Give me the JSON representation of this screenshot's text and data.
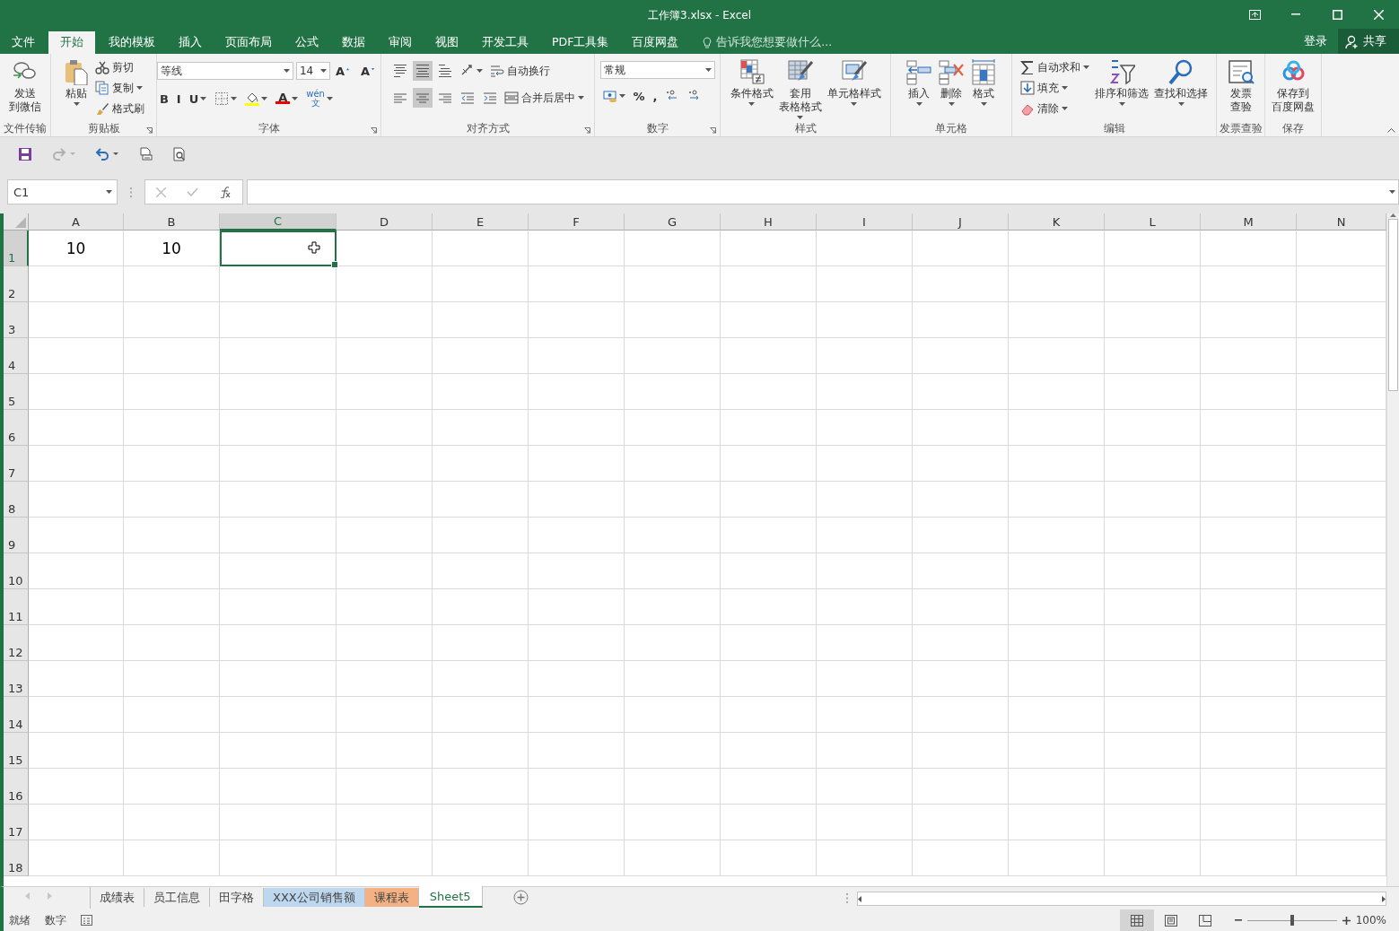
{
  "window": {
    "title": "工作簿3.xlsx - Excel"
  },
  "menu_tabs": [
    {
      "label": "文件",
      "selected": false
    },
    {
      "label": "开始",
      "selected": true
    },
    {
      "label": "我的模板",
      "selected": false
    },
    {
      "label": "插入",
      "selected": false
    },
    {
      "label": "页面布局",
      "selected": false
    },
    {
      "label": "公式",
      "selected": false
    },
    {
      "label": "数据",
      "selected": false
    },
    {
      "label": "审阅",
      "selected": false
    },
    {
      "label": "视图",
      "selected": false
    },
    {
      "label": "开发工具",
      "selected": false
    },
    {
      "label": "PDF工具集",
      "selected": false
    },
    {
      "label": "百度网盘",
      "selected": false
    }
  ],
  "tell_me": {
    "placeholder": "告诉我您想要做什么..."
  },
  "account": {
    "login": "登录",
    "share": "共享"
  },
  "ribbon": [
    {
      "name": "文件传输",
      "launcher": false,
      "items": [
        {
          "kind": "large",
          "lines": [
            "发送",
            "到微信"
          ],
          "dropdown": false
        }
      ]
    },
    {
      "name": "剪贴板",
      "launcher": true,
      "items": [
        {
          "kind": "large",
          "lines": [
            "粘贴"
          ],
          "dropdown": true
        },
        {
          "kind": "stack",
          "items": [
            {
              "label": "剪切",
              "dropdown": false
            },
            {
              "label": "复制",
              "dropdown": true
            },
            {
              "label": "格式刷",
              "dropdown": false
            }
          ]
        }
      ]
    },
    {
      "name": "字体",
      "launcher": true,
      "items": [
        {
          "kind": "toolbars",
          "toolbars": [
            {
              "tools": [
                {
                  "kind": "field",
                  "value": "等线",
                  "dropdown": true
                },
                {
                  "kind": "field",
                  "value": "14",
                  "dropdown": true
                },
                {
                  "kind": "tool",
                  "lines": [
                    "A"
                  ],
                  "dropdown": false
                },
                {
                  "kind": "tool",
                  "lines": [
                    "A"
                  ],
                  "dropdown": false
                }
              ]
            },
            {
              "tools": [
                {
                  "kind": "tool",
                  "lines": [
                    "B"
                  ],
                  "dropdown": false
                },
                {
                  "kind": "tool",
                  "lines": [
                    "I"
                  ],
                  "dropdown": false
                },
                {
                  "kind": "tool",
                  "lines": [
                    "U"
                  ],
                  "dropdown": true
                },
                {
                  "kind": "tool",
                  "dropdown": true
                },
                {
                  "kind": "tool",
                  "dropdown": true
                },
                {
                  "kind": "tool",
                  "lines": [
                    "A"
                  ],
                  "dropdown": true
                },
                {
                  "kind": "tool",
                  "lines": [
                    "wén",
                    "文"
                  ],
                  "dropdown": true
                }
              ]
            }
          ]
        }
      ]
    },
    {
      "name": "对齐方式",
      "launcher": true,
      "items": [
        {
          "kind": "toolbars",
          "toolbars": [
            {
              "tools": [
                {
                  "kind": "tool",
                  "dropdown": false,
                  "on": false
                },
                {
                  "kind": "tool",
                  "dropdown": false,
                  "on": true
                },
                {
                  "kind": "tool",
                  "dropdown": false,
                  "on": false
                },
                {
                  "kind": "tool",
                  "dropdown": true,
                  "on": false
                },
                {
                  "kind": "button",
                  "label": "自动换行",
                  "dropdown": false
                }
              ]
            },
            {
              "tools": [
                {
                  "kind": "tool",
                  "dropdown": false,
                  "on": false
                },
                {
                  "kind": "tool",
                  "dropdown": false,
                  "on": true
                },
                {
                  "kind": "tool",
                  "dropdown": false,
                  "on": false
                },
                {
                  "kind": "tool",
                  "dropdown": false,
                  "on": false
                },
                {
                  "kind": "tool",
                  "dropdown": false,
                  "on": false
                },
                {
                  "kind": "button",
                  "label": "合并后居中",
                  "dropdown": true
                }
              ]
            }
          ]
        }
      ]
    },
    {
      "name": "数字",
      "launcher": true,
      "items": [
        {
          "kind": "toolbars",
          "toolbars": [
            {
              "tools": [
                {
                  "kind": "field",
                  "value": "常规",
                  "dropdown": true
                }
              ]
            },
            {
              "tools": [
                {
                  "kind": "tool",
                  "dropdown": true
                },
                {
                  "kind": "tool",
                  "lines": [
                    "%"
                  ],
                  "dropdown": false
                },
                {
                  "kind": "tool",
                  "lines": [
                    ","
                  ],
                  "dropdown": false
                },
                {
                  "kind": "tool",
                  "dropdown": false
                },
                {
                  "kind": "tool",
                  "dropdown": false
                }
              ]
            }
          ]
        }
      ]
    },
    {
      "name": "样式",
      "launcher": false,
      "items": [
        {
          "kind": "large",
          "lines": [
            "条件格式"
          ],
          "dropdown": true
        },
        {
          "kind": "large",
          "lines": [
            "套用",
            "表格格式"
          ],
          "dropdown": true
        },
        {
          "kind": "large",
          "lines": [
            "单元格样式"
          ],
          "dropdown": true
        }
      ]
    },
    {
      "name": "单元格",
      "launcher": false,
      "items": [
        {
          "kind": "large",
          "lines": [
            "插入"
          ],
          "dropdown": true
        },
        {
          "kind": "large",
          "lines": [
            "删除"
          ],
          "dropdown": true
        },
        {
          "kind": "large",
          "lines": [
            "格式"
          ],
          "dropdown": true
        }
      ]
    },
    {
      "name": "编辑",
      "launcher": false,
      "items": [
        {
          "kind": "stack",
          "items": [
            {
              "label": "自动求和",
              "dropdown": true
            },
            {
              "label": "填充",
              "dropdown": true
            },
            {
              "label": "清除",
              "dropdown": true
            }
          ]
        },
        {
          "kind": "large",
          "lines": [
            "排序和筛选"
          ],
          "dropdown": true
        },
        {
          "kind": "large",
          "lines": [
            "查找和选择"
          ],
          "dropdown": true
        }
      ]
    },
    {
      "name": "发票查验",
      "launcher": false,
      "items": [
        {
          "kind": "large",
          "lines": [
            "发票",
            "查验"
          ],
          "dropdown": false
        }
      ]
    },
    {
      "name": "保存",
      "launcher": false,
      "items": [
        {
          "kind": "large",
          "lines": [
            "保存到",
            "百度网盘"
          ],
          "dropdown": false
        }
      ]
    }
  ],
  "quick_access": [
    {
      "kind": "save"
    },
    {
      "kind": "redo",
      "disabled": true
    },
    {
      "kind": "undo",
      "disabled": false
    },
    {
      "kind": "print"
    },
    {
      "kind": "preview"
    }
  ],
  "formula_bar": {
    "name_box": "C1"
  },
  "sheet": {
    "columns": [
      {
        "label": "A",
        "selected": false
      },
      {
        "label": "B",
        "selected": false
      },
      {
        "label": "C",
        "selected": true
      },
      {
        "label": "D",
        "selected": false
      },
      {
        "label": "E",
        "selected": false
      },
      {
        "label": "F",
        "selected": false
      },
      {
        "label": "G",
        "selected": false
      },
      {
        "label": "H",
        "selected": false
      },
      {
        "label": "I",
        "selected": false
      },
      {
        "label": "J",
        "selected": false
      },
      {
        "label": "K",
        "selected": false
      },
      {
        "label": "L",
        "selected": false
      },
      {
        "label": "M",
        "selected": false
      },
      {
        "label": "N",
        "selected": false
      }
    ],
    "rows": [
      {
        "label": "1",
        "selected": true,
        "values": [
          "10",
          "10"
        ]
      },
      {
        "label": "2",
        "selected": false
      },
      {
        "label": "3",
        "selected": false
      },
      {
        "label": "4",
        "selected": false
      },
      {
        "label": "5",
        "selected": false
      },
      {
        "label": "6",
        "selected": false
      },
      {
        "label": "7",
        "selected": false
      },
      {
        "label": "8",
        "selected": false
      },
      {
        "label": "9",
        "selected": false
      },
      {
        "label": "10",
        "selected": false
      },
      {
        "label": "11",
        "selected": false
      },
      {
        "label": "12",
        "selected": false
      },
      {
        "label": "13",
        "selected": false
      },
      {
        "label": "14",
        "selected": false
      },
      {
        "label": "15",
        "selected": false
      },
      {
        "label": "16",
        "selected": false
      },
      {
        "label": "17",
        "selected": false
      },
      {
        "label": "18",
        "selected": false
      }
    ]
  },
  "sheet_tabs": [
    {
      "label": "成绩表",
      "selected": false
    },
    {
      "label": "员工信息",
      "selected": false
    },
    {
      "label": "田字格",
      "selected": false
    },
    {
      "label": "XXX公司销售额",
      "selected": false,
      "color": "#bdd7ee"
    },
    {
      "label": "课程表",
      "selected": false,
      "color": "#f4b183"
    },
    {
      "label": "Sheet5",
      "selected": true
    }
  ],
  "status_bar": {
    "mode": "就绪",
    "keyboard": "数字",
    "views": [
      {
        "kind": "normal",
        "selected": true
      },
      {
        "kind": "layout",
        "selected": false
      },
      {
        "kind": "pagebreak",
        "selected": false
      }
    ],
    "zoom_slider": {
      "level": 0.5
    },
    "zoom": "100%"
  }
}
